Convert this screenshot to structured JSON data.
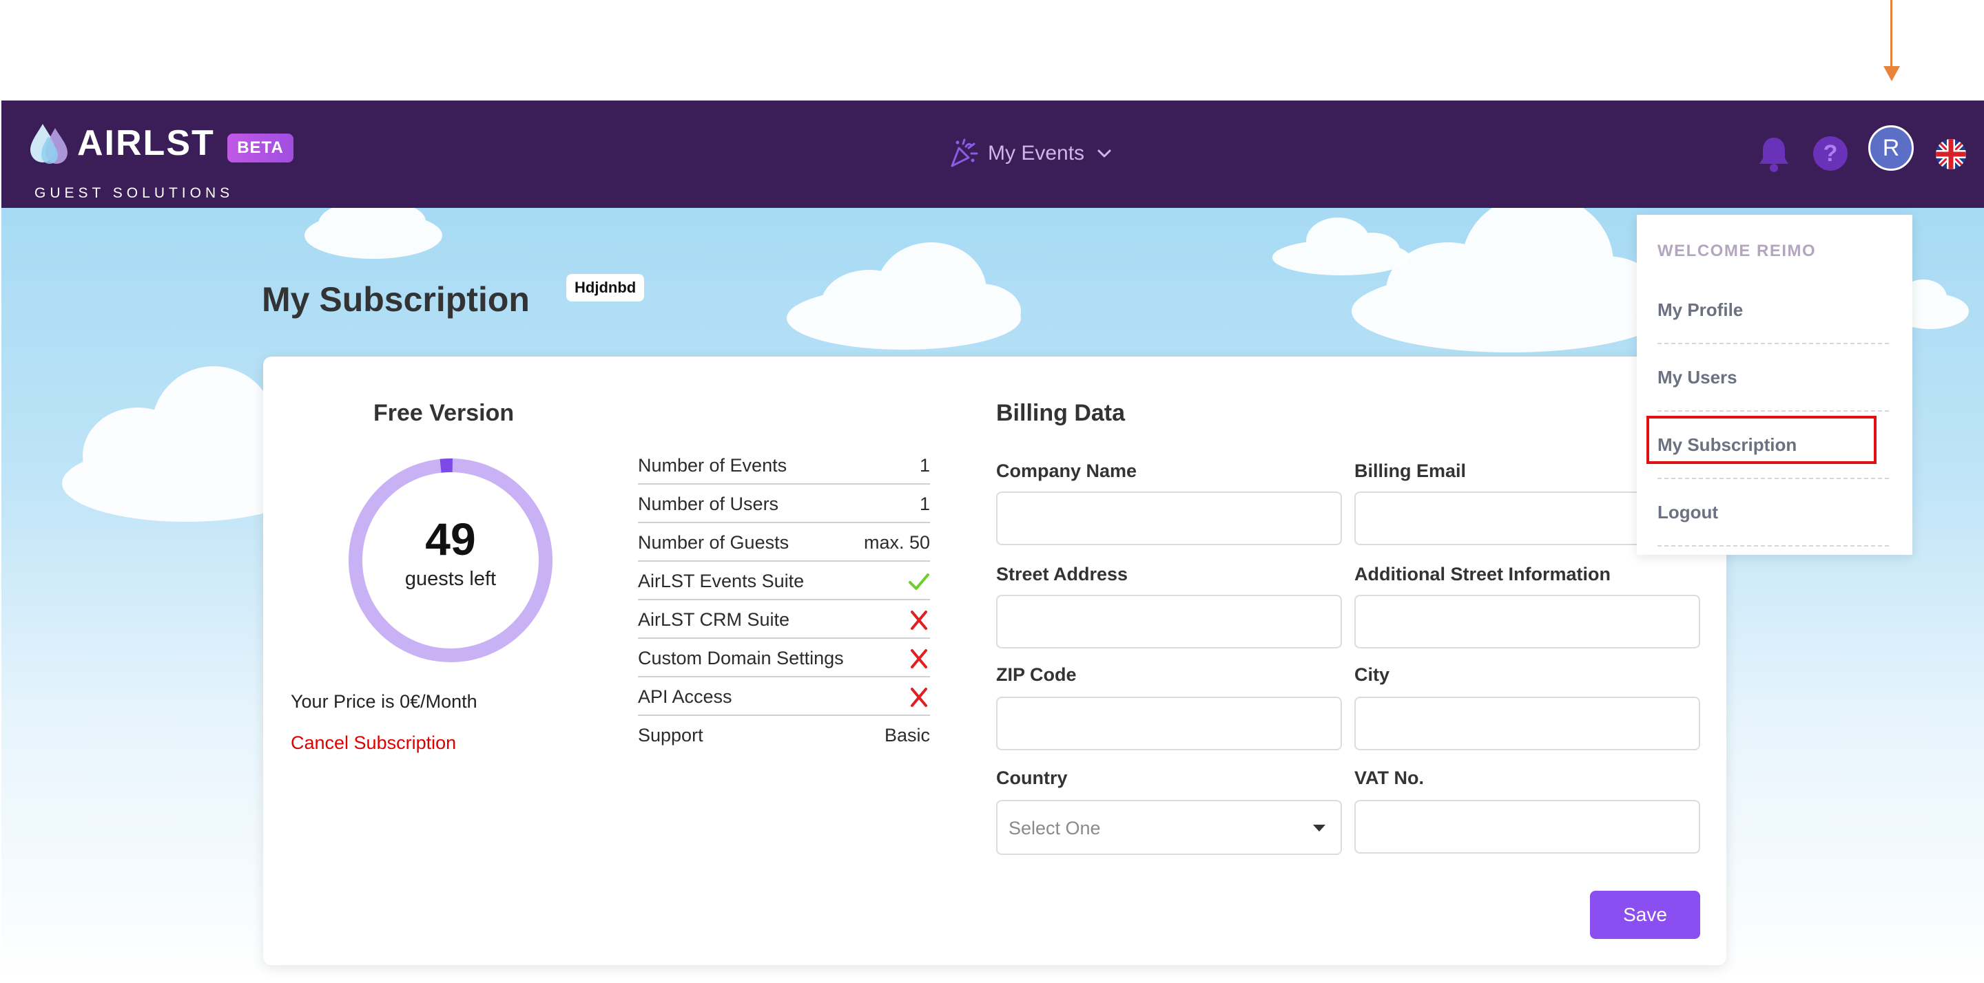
{
  "header": {
    "logo_text": "AIRLST",
    "logo_subtitle": "GUEST SOLUTIONS",
    "beta_badge": "BETA",
    "nav_events_label": "My Events",
    "avatar_initial": "R",
    "help_glyph": "?",
    "icons": [
      "confetti-icon",
      "chevron-down-icon",
      "bell-icon",
      "help-icon",
      "uk-flag-icon"
    ]
  },
  "page": {
    "title": "My Subscription",
    "org_badge": "Hdjdnbd"
  },
  "plan": {
    "title": "Free Version",
    "guests_left_value": "49",
    "guests_left_label": "guests left",
    "guests_used_fraction": 0.02,
    "price_text": "Your Price is 0€/Month",
    "cancel_label": "Cancel Subscription"
  },
  "features": [
    {
      "name": "Number of Events",
      "value": "1"
    },
    {
      "name": "Number of Users",
      "value": "1"
    },
    {
      "name": "Number of Guests",
      "value": "max. 50"
    },
    {
      "name": "AirLST Events Suite",
      "icon": "check-icon"
    },
    {
      "name": "AirLST CRM Suite",
      "icon": "cross-icon"
    },
    {
      "name": "Custom Domain Settings",
      "icon": "cross-icon"
    },
    {
      "name": "API Access",
      "icon": "cross-icon"
    },
    {
      "name": "Support",
      "value": "Basic"
    }
  ],
  "billing": {
    "title": "Billing Data",
    "company_name_label": "Company Name",
    "company_name_value": "",
    "billing_email_label": "Billing Email",
    "billing_email_value": "",
    "street_label": "Street Address",
    "street_value": "",
    "additional_street_label": "Additional Street Information",
    "additional_street_value": "",
    "zip_label": "ZIP Code",
    "zip_value": "",
    "city_label": "City",
    "city_value": "",
    "country_label": "Country",
    "country_selected": "Select One",
    "vat_label": "VAT No.",
    "vat_value": "",
    "save_label": "Save"
  },
  "user_menu": {
    "welcome": "WELCOME REIMO",
    "items": [
      "My Profile",
      "My Users",
      "My Subscription",
      "Logout"
    ],
    "highlighted_item": "My Subscription"
  },
  "colors": {
    "header_bg": "#3b1d58",
    "accent": "#8b4ef0",
    "donut_ring": "#c8b2f5",
    "donut_used": "#7b4ae8",
    "cancel_red": "#e00000",
    "check_green": "#6ccf2a",
    "cross_red": "#e02020",
    "annotation_arrow": "#e8843a",
    "highlight_box": "#e01010"
  }
}
